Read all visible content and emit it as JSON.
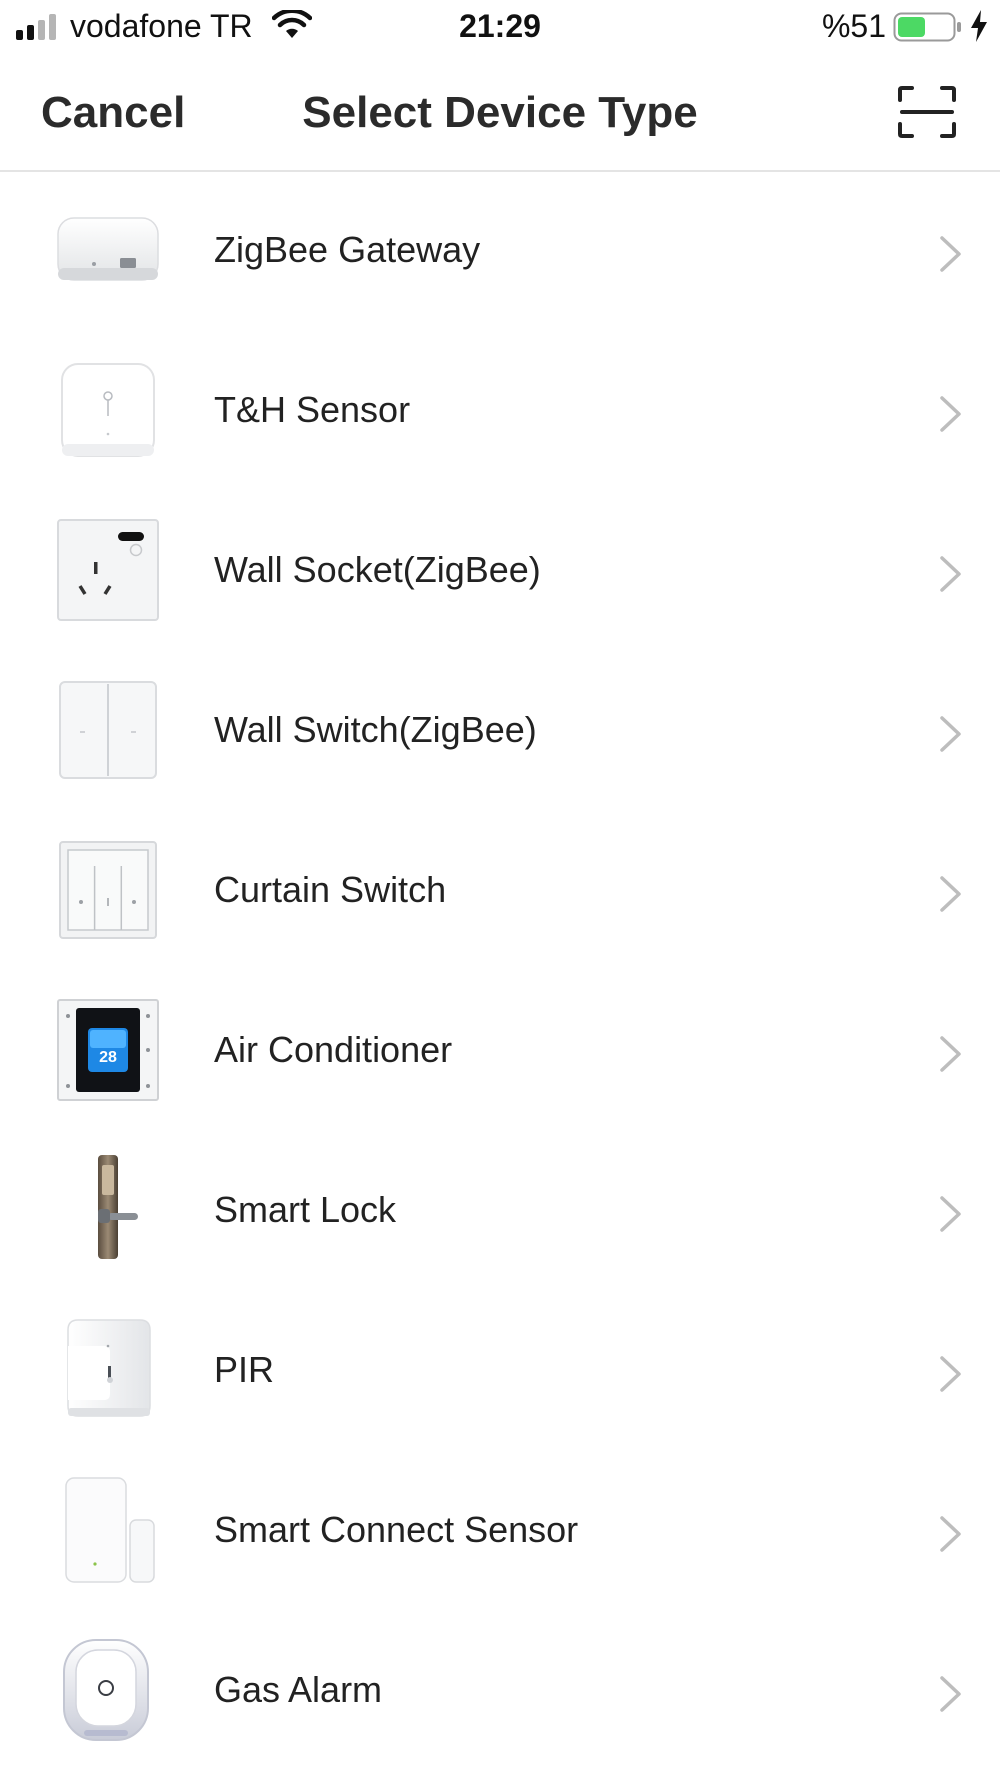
{
  "status_bar": {
    "carrier": "vodafone TR",
    "time": "21:29",
    "battery_percent": "%51",
    "battery_level": 0.51,
    "signal_bars": 2,
    "charging": true,
    "battery_color": "#4cd964"
  },
  "nav": {
    "cancel_label": "Cancel",
    "title": "Select Device Type",
    "scan_icon": "scan-icon"
  },
  "devices": [
    {
      "label": "ZigBee Gateway",
      "icon": "zigbee-gateway-icon"
    },
    {
      "label": "T&H Sensor",
      "icon": "th-sensor-icon"
    },
    {
      "label": "Wall Socket(ZigBee)",
      "icon": "wall-socket-icon"
    },
    {
      "label": "Wall Switch(ZigBee)",
      "icon": "wall-switch-icon"
    },
    {
      "label": "Curtain Switch",
      "icon": "curtain-switch-icon"
    },
    {
      "label": "Air Conditioner",
      "icon": "air-conditioner-icon"
    },
    {
      "label": "Smart Lock",
      "icon": "smart-lock-icon"
    },
    {
      "label": "PIR",
      "icon": "pir-sensor-icon"
    },
    {
      "label": "Smart Connect Sensor",
      "icon": "door-sensor-icon"
    },
    {
      "label": "Gas Alarm",
      "icon": "gas-alarm-icon"
    }
  ],
  "thermostat_display": "28"
}
